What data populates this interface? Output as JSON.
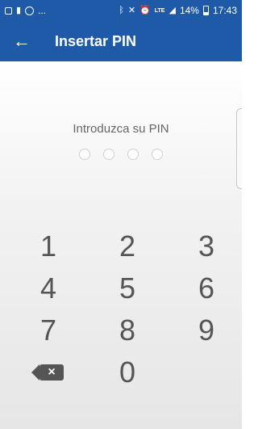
{
  "status_bar": {
    "dots": "...",
    "battery_percent": "14%",
    "network": "LTE",
    "time": "17:43",
    "icons": [
      "gallery-icon",
      "notification-icon",
      "account-circle-icon",
      "bluetooth-icon",
      "mute-icon",
      "alarm-icon",
      "signal-icon",
      "battery-icon"
    ]
  },
  "app_bar": {
    "back_icon": "←",
    "title": "Insertar PIN"
  },
  "pin": {
    "prompt": "Introduzca su PIN",
    "length": 4
  },
  "keypad": {
    "k1": "1",
    "k2": "2",
    "k3": "3",
    "k4": "4",
    "k5": "5",
    "k6": "6",
    "k7": "7",
    "k8": "8",
    "k9": "9",
    "k0": "0",
    "delete_symbol": "×"
  },
  "colors": {
    "primary": "#1e5aa8",
    "key_text": "#555555"
  }
}
